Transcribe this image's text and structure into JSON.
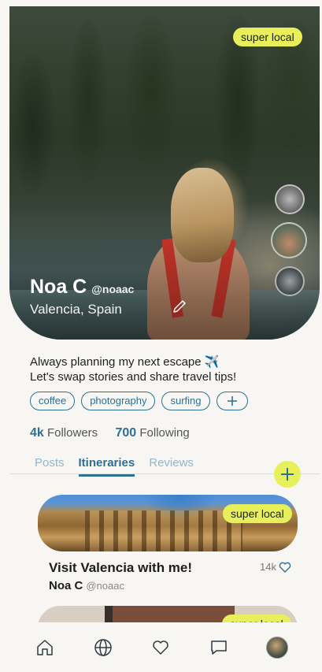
{
  "hero": {
    "badge": "super local",
    "name": "Noa C",
    "handle": "@noaac",
    "location": "Valencia, Spain"
  },
  "bio": {
    "line1": "Always planning my next escape ✈️",
    "line2": "Let's swap stories and share travel tips!"
  },
  "tags": [
    "coffee",
    "photography",
    "surfing"
  ],
  "stats": {
    "followers_count": "4k",
    "followers_label": "Followers",
    "following_count": "700",
    "following_label": "Following"
  },
  "tabs": [
    "Posts",
    "Itineraries",
    "Reviews"
  ],
  "active_tab": "Itineraries",
  "card1": {
    "badge": "super local",
    "title": "Visit Valencia with me!",
    "author": "Noa C",
    "handle": "@noaac",
    "likes": "14k"
  },
  "card2": {
    "badge": "super local"
  },
  "nav": [
    "home-icon",
    "globe-icon",
    "heart-icon",
    "chat-icon",
    "avatar"
  ],
  "colors": {
    "accent": "#e7f05a",
    "primary": "#2f6f92"
  }
}
